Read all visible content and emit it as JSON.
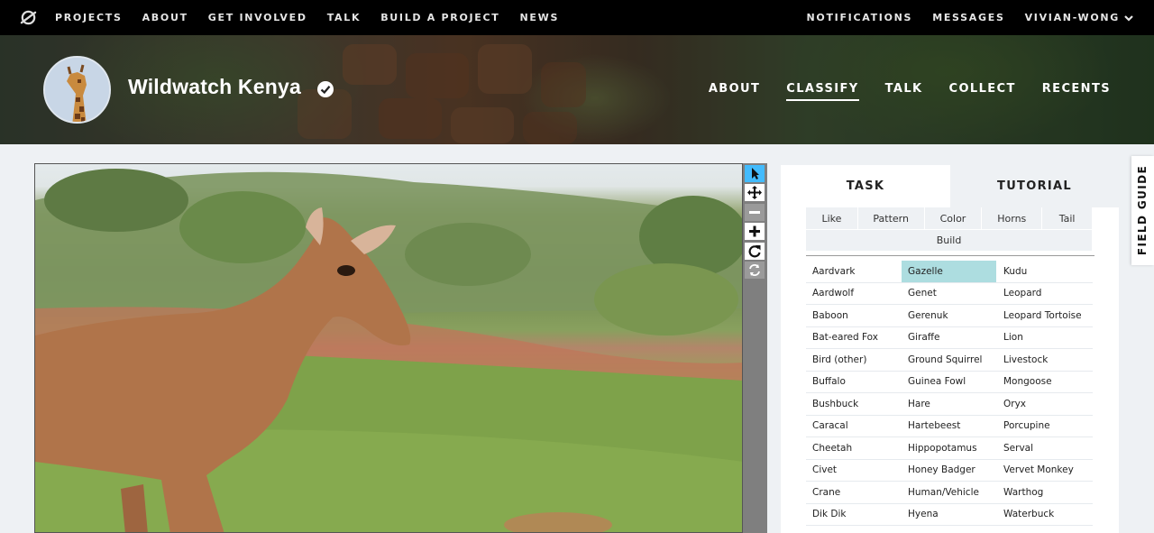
{
  "topbar": {
    "logo_icon": "zooniverse-logo-icon",
    "nav_left": [
      "PROJECTS",
      "ABOUT",
      "GET INVOLVED",
      "TALK",
      "BUILD A PROJECT",
      "NEWS"
    ],
    "notifications": "NOTIFICATIONS",
    "messages": "MESSAGES",
    "user": "VIVIAN-WONG"
  },
  "project": {
    "title": "Wildwatch Kenya",
    "verified_icon": "check-circle-icon",
    "nav": [
      "ABOUT",
      "CLASSIFY",
      "TALK",
      "COLLECT",
      "RECENTS"
    ],
    "active_nav": "CLASSIFY"
  },
  "tools": {
    "items": [
      "pointer-icon",
      "move-icon",
      "zoom-out-icon",
      "zoom-in-icon",
      "rotate-icon",
      "reset-icon"
    ],
    "active": "pointer-icon"
  },
  "panel": {
    "tab_task": "TASK",
    "tab_tutorial": "TUTORIAL",
    "filters": [
      "Like",
      "Pattern",
      "Color",
      "Horns",
      "Tail"
    ],
    "filter_build": "Build",
    "selected_species": "Gazelle",
    "species": [
      [
        "Aardvark",
        "Gazelle",
        "Kudu"
      ],
      [
        "Aardwolf",
        "Genet",
        "Leopard"
      ],
      [
        "Baboon",
        "Gerenuk",
        "Leopard Tortoise"
      ],
      [
        "Bat-eared Fox",
        "Giraffe",
        "Lion"
      ],
      [
        "Bird (other)",
        "Ground Squirrel",
        "Livestock"
      ],
      [
        "Buffalo",
        "Guinea Fowl",
        "Mongoose"
      ],
      [
        "Bushbuck",
        "Hare",
        "Oryx"
      ],
      [
        "Caracal",
        "Hartebeest",
        "Porcupine"
      ],
      [
        "Cheetah",
        "Hippopotamus",
        "Serval"
      ],
      [
        "Civet",
        "Honey Badger",
        "Vervet Monkey"
      ],
      [
        "Crane",
        "Human/Vehicle",
        "Warthog"
      ],
      [
        "Dik Dik",
        "Hyena",
        "Waterbuck"
      ]
    ]
  },
  "field_guide": "FIELD GUIDE",
  "colors": {
    "topbar": "#000000",
    "active_tool": "#43bbfd",
    "selected_species": "#addde0",
    "panel_tab_inactive": "#eef1f4"
  }
}
